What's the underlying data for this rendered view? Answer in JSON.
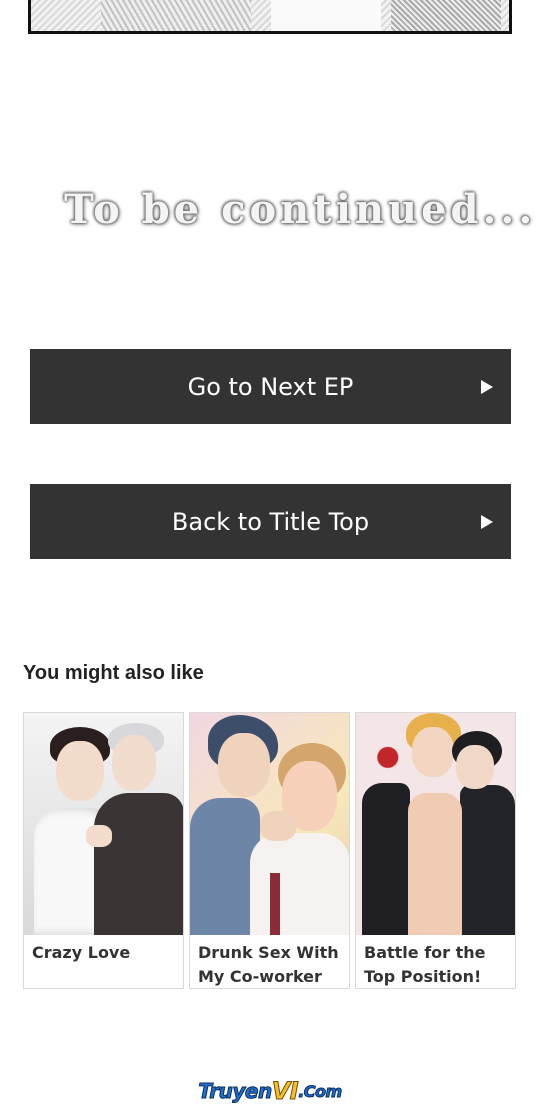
{
  "story": {
    "end_text": "To be continued..."
  },
  "navigation": {
    "next_label": "Go to Next EP",
    "back_label": "Back to Title Top"
  },
  "recommendations": {
    "heading": "You might also like",
    "items": [
      {
        "title": "Crazy Love"
      },
      {
        "title": "Drunk Sex With My Co-worker"
      },
      {
        "title": "Battle for the Top Position!"
      }
    ]
  },
  "footer": {
    "logo_part1": "Truyen",
    "logo_part2": "VI",
    "logo_part3": ".Com"
  },
  "colors": {
    "button_bg": "#333333",
    "button_text": "#ffffff",
    "logo_blue": "#1e6fd0",
    "logo_yellow": "#f2c02a"
  },
  "icons": {
    "button_arrow": "play-triangle-icon"
  }
}
